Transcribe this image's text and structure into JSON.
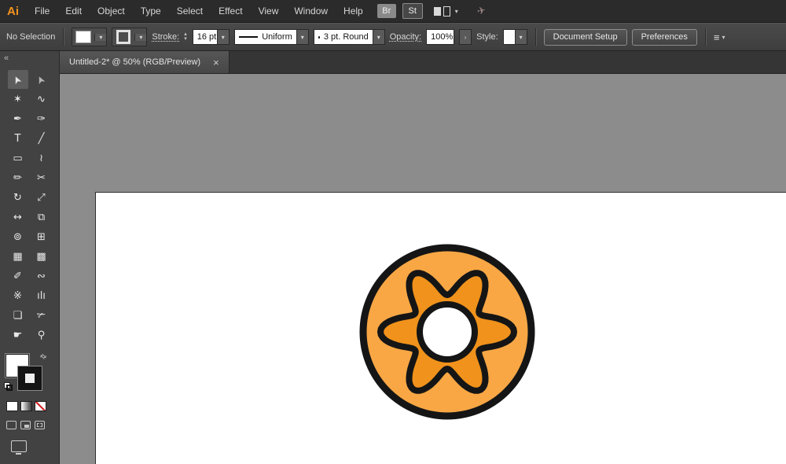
{
  "menubar": {
    "logo": "Ai",
    "items": [
      "File",
      "Edit",
      "Object",
      "Type",
      "Select",
      "Effect",
      "View",
      "Window",
      "Help"
    ],
    "badges": [
      "Br",
      "St"
    ]
  },
  "controlbar": {
    "selection": "No Selection",
    "stroke_label": "Stroke:",
    "stroke_value": "16 pt",
    "profile": "Uniform",
    "brush": "3 pt. Round",
    "opacity_label": "Opacity:",
    "opacity_value": "100%",
    "opacity_expand": "›",
    "style_label": "Style:",
    "doc_setup": "Document Setup",
    "preferences": "Preferences"
  },
  "tabbar": {
    "title": "Untitled-2* @ 50% (RGB/Preview)",
    "close": "×",
    "collapse": "«"
  },
  "toolbar": {
    "tools": [
      {
        "name": "selection-tool",
        "glyph": "➤",
        "rotate": -115,
        "selected": true
      },
      {
        "name": "direct-selection-tool",
        "glyph": "➤",
        "rotate": -115,
        "color": "#b5b5b5"
      },
      {
        "name": "magic-wand-tool",
        "glyph": "✶"
      },
      {
        "name": "lasso-tool",
        "glyph": "∿"
      },
      {
        "name": "pen-tool",
        "glyph": "✒"
      },
      {
        "name": "curvature-tool",
        "glyph": "✑"
      },
      {
        "name": "type-tool",
        "glyph": "T"
      },
      {
        "name": "line-segment-tool",
        "glyph": "╱"
      },
      {
        "name": "rectangle-tool",
        "glyph": "▭"
      },
      {
        "name": "paintbrush-tool",
        "glyph": "≀"
      },
      {
        "name": "pencil-tool",
        "glyph": "✏"
      },
      {
        "name": "scissors-tool",
        "glyph": "✂"
      },
      {
        "name": "rotate-tool",
        "glyph": "↻"
      },
      {
        "name": "scale-tool",
        "glyph": "⤢"
      },
      {
        "name": "width-tool",
        "glyph": "↔"
      },
      {
        "name": "free-transform-tool",
        "glyph": "⧉"
      },
      {
        "name": "shape-builder-tool",
        "glyph": "⊚"
      },
      {
        "name": "perspective-grid-tool",
        "glyph": "⊞"
      },
      {
        "name": "mesh-tool",
        "glyph": "▦"
      },
      {
        "name": "gradient-tool",
        "glyph": "▩"
      },
      {
        "name": "eyedropper-tool",
        "glyph": "✐"
      },
      {
        "name": "blend-tool",
        "glyph": "∾"
      },
      {
        "name": "symbol-sprayer-tool",
        "glyph": "※"
      },
      {
        "name": "column-graph-tool",
        "glyph": "ılı"
      },
      {
        "name": "artboard-tool",
        "glyph": "❏"
      },
      {
        "name": "slice-tool",
        "glyph": "✃"
      },
      {
        "name": "hand-tool",
        "glyph": "☛"
      },
      {
        "name": "zoom-tool",
        "glyph": "⚲"
      }
    ]
  },
  "colors": {
    "logo": "#F7941E",
    "current_fill": "#FFFFFF",
    "current_stroke": "#000000",
    "pasteboard": "#8C8C8C"
  },
  "artwork": {
    "size": 232,
    "ring_r": 107,
    "ring_stroke": 9,
    "gear_base": 66,
    "gear_amp": 19,
    "gear_lobes": 6,
    "gear_stroke": 8,
    "hole_r": 35,
    "hole_stroke": 8,
    "colors": {
      "ring": "#F8A744",
      "gear": "#F0921B",
      "hole": "#FFFFFF",
      "outline": "#151515"
    }
  }
}
